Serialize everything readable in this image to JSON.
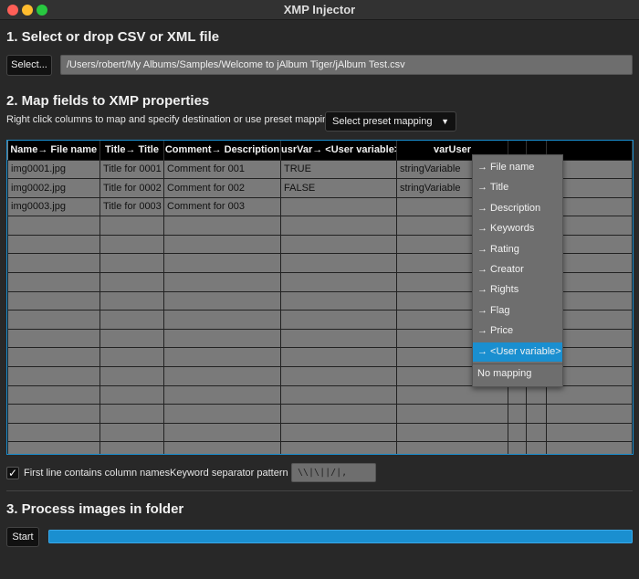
{
  "window": {
    "title": "XMP Injector"
  },
  "section1": {
    "heading": "1. Select or drop CSV or XML file",
    "select_label": "Select...",
    "path": "/Users/robert/My Albums/Samples/Welcome to jAlbum Tiger/jAlbum Test.csv"
  },
  "section2": {
    "heading": "2. Map fields to XMP properties",
    "instruction": "Right click columns to map and specify destination or use preset mapping",
    "preset_label": "Select preset mapping"
  },
  "table": {
    "columns": [
      "Name→ File name",
      "Title→ Title",
      "Comment→ Description",
      "usrVar→ <User variable>",
      "varUser",
      "",
      "",
      ""
    ],
    "rows": [
      [
        "img0001.jpg",
        "Title for 0001",
        "Comment for 001",
        "TRUE",
        "stringVariable",
        "",
        "",
        ""
      ],
      [
        "img0002.jpg",
        "Title for 0002",
        "Comment for 002",
        "FALSE",
        "stringVariable",
        "",
        "",
        ""
      ],
      [
        "img0003.jpg",
        "Title for 0003",
        "Comment for 003",
        "",
        "",
        "",
        "",
        ""
      ]
    ]
  },
  "context_menu": {
    "items": [
      "→ File name",
      "→ Title",
      "→ Description",
      "→ Keywords",
      "→ Rating",
      "→ Creator",
      "→ Rights",
      "→ Flag",
      "→ Price",
      "→ <User variable>"
    ],
    "selected": "→ <User variable>",
    "no_mapping": "No mapping"
  },
  "options": {
    "first_line_label": "First line contains column names",
    "first_line_checked": true,
    "separator_label": "Keyword separator pattern",
    "separator_value": "\\\\|\\||/|,"
  },
  "section3": {
    "heading": "3. Process images in folder",
    "start_label": "Start",
    "progress": 1.0
  },
  "colors": {
    "accent": "#1a8fd0"
  }
}
